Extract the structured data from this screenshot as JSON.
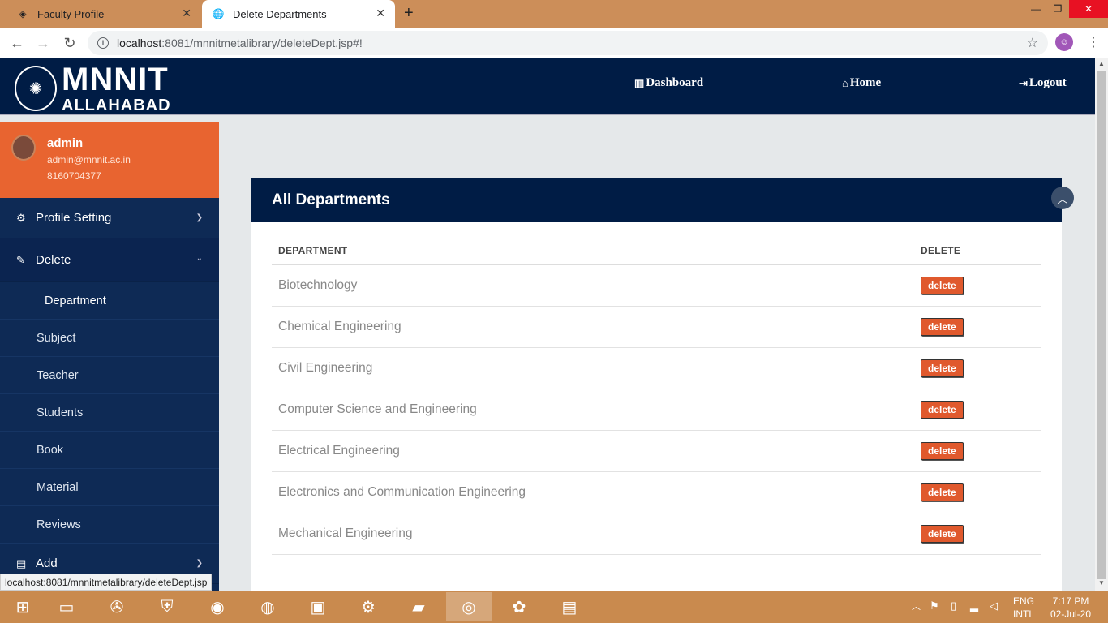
{
  "browser": {
    "tabs": [
      {
        "title": "Faculty Profile",
        "active": false
      },
      {
        "title": "Delete Departments",
        "active": true
      }
    ],
    "url_host": "localhost",
    "url_rest": ":8081/mnnitmetalibrary/deleteDept.jsp#!",
    "status_url": "localhost:8081/mnnitmetalibrary/deleteDept.jsp"
  },
  "header": {
    "logo_line1": "MNNIT",
    "logo_line2": "ALLAHABAD",
    "nav": [
      {
        "label": "Dashboard",
        "icon": "bar-chart-icon"
      },
      {
        "label": "Home",
        "icon": "home-icon"
      },
      {
        "label": "Logout",
        "icon": "logout-icon"
      }
    ]
  },
  "user": {
    "name": "admin",
    "email": "admin@mnnit.ac.in",
    "phone": "8160704377"
  },
  "sidebar": {
    "profile_setting": "Profile Setting",
    "delete": "Delete",
    "delete_items": [
      "Department",
      "Subject",
      "Teacher",
      "Students",
      "Book",
      "Material",
      "Reviews"
    ],
    "add": "Add"
  },
  "main": {
    "card_title": "All Departments",
    "columns": [
      "DEPARTMENT",
      "DELETE"
    ],
    "delete_label": "delete",
    "departments": [
      "Biotechnology",
      "Chemical Engineering",
      "Civil Engineering",
      "Computer Science and Engineering",
      "Electrical Engineering",
      "Electronics and Communication Engineering",
      "Mechanical Engineering"
    ]
  },
  "taskbar": {
    "lang1": "ENG",
    "lang2": "INTL",
    "time": "7:17 PM",
    "date": "02-Jul-20"
  },
  "colors": {
    "navy": "#001c45",
    "sidebar": "#0e2a55",
    "accent_orange": "#e86430",
    "delete_button": "#e0592d"
  }
}
